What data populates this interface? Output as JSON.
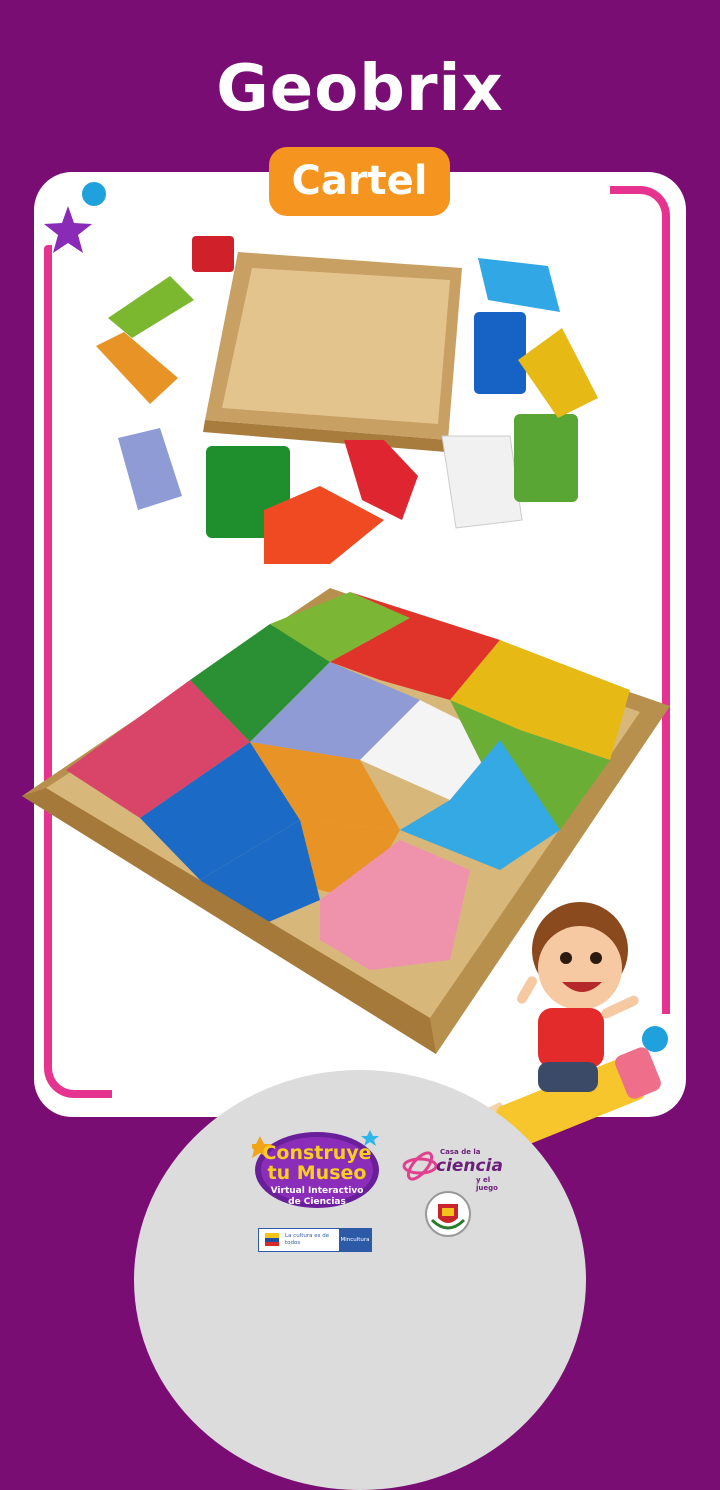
{
  "header": {
    "title": "Geobrix"
  },
  "badge": {
    "label": "Cartel"
  },
  "logos": {
    "construye": {
      "line1": "Construye",
      "line2": "tu Museo",
      "line3": "Virtual Interactivo",
      "line4": "de Ciencias"
    },
    "casa_ciencia": {
      "prefix": "Casa de la",
      "name": "ciencia",
      "suffix": "y el juego"
    },
    "mincultura": {
      "slogan": "La cultura es de todos",
      "name": "Mincultura"
    }
  },
  "colors": {
    "background": "#7a0d74",
    "card": "#ffffff",
    "frame": "#e6338f",
    "badge": "#f5941e",
    "accent_dot": "#1ea1dc",
    "star": "#8a2bb8"
  }
}
